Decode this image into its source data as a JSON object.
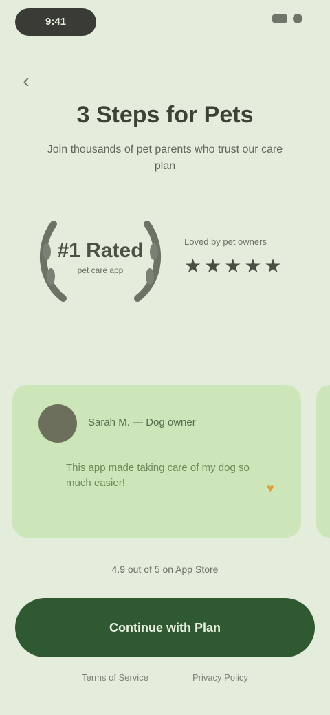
{
  "status_bar": {
    "time": "9:41"
  },
  "header": {
    "title": "3 Steps for Pets",
    "subtitle": "Join thousands of pet parents who trust our care plan"
  },
  "badge": {
    "main": "#1 Rated",
    "sub": "pet care app"
  },
  "rating": {
    "caption": "Loved by pet owners",
    "stars": [
      "★",
      "★",
      "★",
      "★",
      "★"
    ],
    "value": 5
  },
  "review": {
    "name": "Sarah M. — Dog owner",
    "text": "This app made taking care of my dog so much easier!",
    "emoji": "♥"
  },
  "trust_note": "4.9 out of 5 on App Store",
  "cta": {
    "label": "Continue with Plan"
  },
  "footer": {
    "links": [
      "Terms of Service",
      "Privacy Policy"
    ]
  },
  "colors": {
    "background": "#e4eddc",
    "card": "#cde6b9",
    "cta": "#2f5a31"
  }
}
